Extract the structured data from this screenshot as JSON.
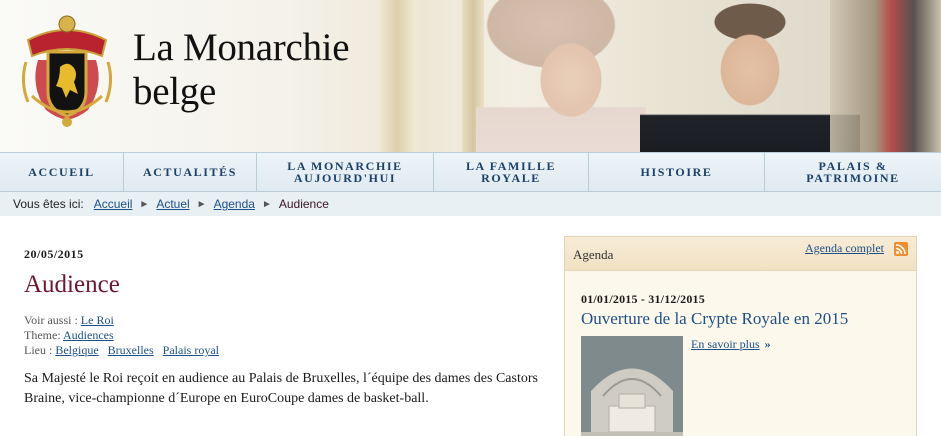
{
  "site": {
    "title_line1": "La Monarchie",
    "title_line2": "belge"
  },
  "nav": {
    "items": [
      {
        "label": "ACCUEIL"
      },
      {
        "label": "ACTUALITÉS"
      },
      {
        "label_line1": "LA MONARCHIE",
        "label_line2": "AUJOURD'HUI"
      },
      {
        "label_line1": "LA FAMILLE",
        "label_line2": "ROYALE"
      },
      {
        "label": "HISTOIRE"
      },
      {
        "label_line1": "PALAIS &",
        "label_line2": "PATRIMOINE"
      }
    ]
  },
  "breadcrumb": {
    "label": "Vous êtes ici:",
    "items": [
      "Accueil",
      "Actuel",
      "Agenda"
    ],
    "current": "Audience"
  },
  "article": {
    "date": "20/05/2015",
    "title": "Audience",
    "see_also_label": "Voir aussi :",
    "see_also": [
      "Le Roi"
    ],
    "theme_label": "Theme:",
    "theme": [
      "Audiences"
    ],
    "place_label": "Lieu :",
    "places": [
      "Belgique",
      "Bruxelles",
      "Palais royal"
    ],
    "body": "Sa Majesté le Roi reçoit en audience au Palais de Bruxelles, l´équipe des dames des Castors Braine, vice-championne d´Europe en EuroCoupe dames de basket-ball."
  },
  "agenda": {
    "title": "Agenda",
    "full_link": "Agenda complet",
    "event": {
      "date": "01/01/2015 - 31/12/2015",
      "title": "Ouverture de la Crypte Royale en 2015",
      "more": "En savoir plus",
      "more_arrow": "»"
    }
  },
  "icons": [
    "crest-icon",
    "rss-icon",
    "chevron-right-icon"
  ],
  "colors": {
    "nav_text": "#1c4168",
    "link": "#1d4f87",
    "title": "#6d1731",
    "rss": "#f08d2f"
  }
}
